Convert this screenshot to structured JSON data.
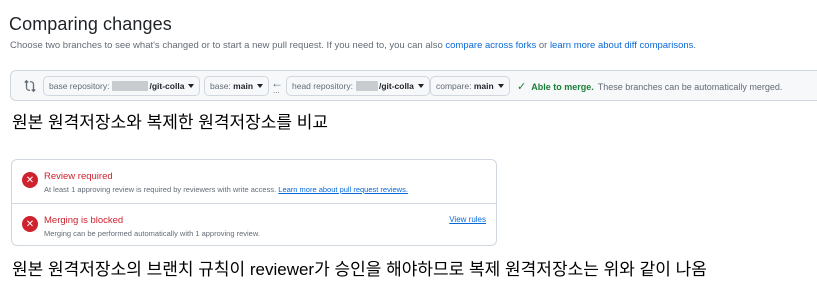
{
  "header": {
    "title": "Comparing changes",
    "subtitle_before": "Choose two branches to see what's changed or to start a new pull request. If you need to, you can also",
    "link_compare_forks": "compare across forks",
    "subtitle_or": "or",
    "link_learn_diff": "learn more about diff comparisons",
    "subtitle_end": "."
  },
  "range_bar": {
    "base_repo_label": "base repository:",
    "base_repo_value": "/git-colla",
    "base_branch_label": "base:",
    "base_branch_value": "main",
    "head_repo_label": "head repository:",
    "head_repo_value": "/git-colla",
    "compare_label": "compare:",
    "compare_value": "main",
    "swap_arrow": "←",
    "swap_dots": "...",
    "merge_check": "✓",
    "merge_status_strong": "Able to merge.",
    "merge_status_text": "These branches can be automatically merged."
  },
  "caption_top": "원본 원격저장소와 복제한 원격저장소를 비교",
  "checks": [
    {
      "icon": "✕",
      "title": "Review required",
      "desc_text": "At least 1 approving review is required by reviewers with write access.",
      "desc_link": "Learn more about pull request reviews."
    },
    {
      "icon": "✕",
      "title": "Merging is blocked",
      "desc_text": "Merging can be performed automatically with 1 approving review.",
      "action": "View rules"
    }
  ],
  "caption_bottom": "원본 원격저장소의 브랜치 규칙이 reviewer가 승인을 해야하므로 복제 원격저장소는 위와 같이 나옴",
  "colors": {
    "accent_link": "#0969da",
    "success": "#1a7f37",
    "danger": "#cf222e",
    "muted": "#636c76",
    "border": "#d0d7de"
  }
}
